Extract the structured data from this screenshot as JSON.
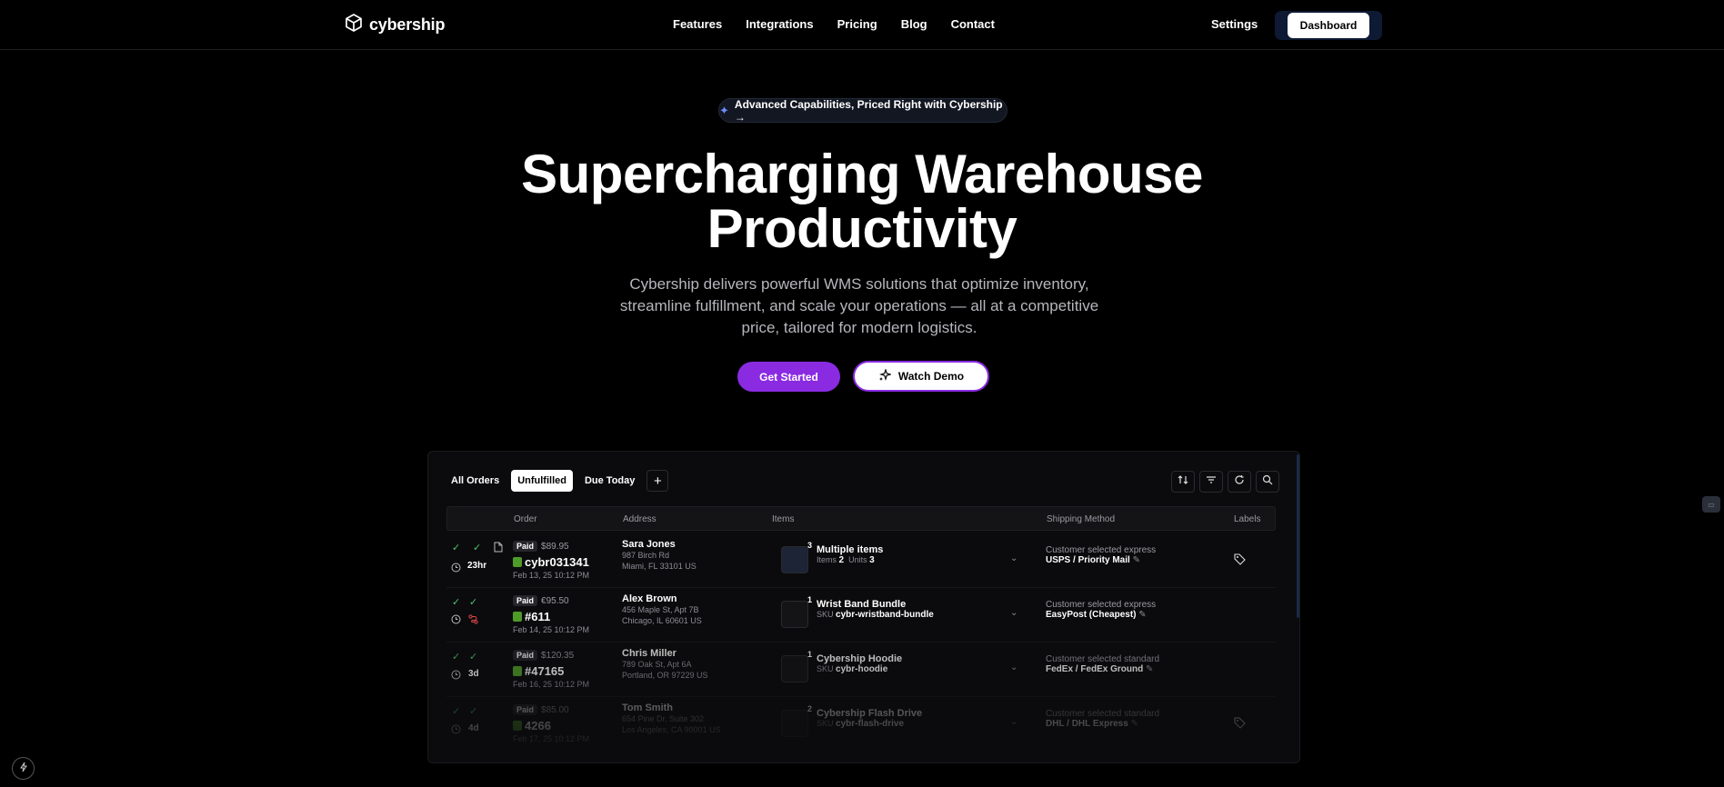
{
  "nav": {
    "brand": "cybership",
    "links": [
      "Features",
      "Integrations",
      "Pricing",
      "Blog",
      "Contact"
    ],
    "settings": "Settings",
    "dashboard": "Dashboard"
  },
  "hero": {
    "pill": "Advanced Capabilities, Priced Right with Cybership →",
    "title_line1": "Supercharging Warehouse",
    "title_line2": "Productivity",
    "subtitle": "Cybership delivers powerful WMS solutions that optimize inventory, streamline fulfillment, and scale your operations — all at a competitive price, tailored for modern logistics.",
    "primary_cta": "Get Started",
    "secondary_cta": "Watch Demo"
  },
  "orders": {
    "tabs": [
      "All Orders",
      "Unfulfilled",
      "Due Today"
    ],
    "active_tab": "Unfulfilled",
    "headers": {
      "order": "Order",
      "address": "Address",
      "items": "Items",
      "shipping": "Shipping Method",
      "labels": "Labels"
    },
    "rows": [
      {
        "age": "23hr",
        "status": "Paid",
        "price": "$89.95",
        "order": "cybr031341",
        "date": "Feb 13, 25 10:12 PM",
        "name": "Sara Jones",
        "addr1": "987 Birch Rd",
        "addr2": "Miami, FL 33101 US",
        "qty": "3",
        "item": "Multiple items",
        "items_label": "Items",
        "items_count": "2",
        "units_label": "Units",
        "units_count": "3",
        "ship_note": "Customer selected express",
        "carrier": "USPS / Priority Mail"
      },
      {
        "age": "",
        "status": "Paid",
        "price": "€95.50",
        "order": "#611",
        "date": "Feb 14, 25 10:12 PM",
        "name": "Alex Brown",
        "addr1": "456 Maple St, Apt 7B",
        "addr2": "Chicago, IL 60601 US",
        "qty": "1",
        "item": "Wrist Band Bundle",
        "sku_label": "SKU",
        "sku": "cybr-wristband-bundle",
        "ship_note": "Customer selected express",
        "carrier": "EasyPost (Cheapest)"
      },
      {
        "age": "3d",
        "status": "Paid",
        "price": "$120.35",
        "order": "#47165",
        "date": "Feb 16, 25 10:12 PM",
        "name": "Chris Miller",
        "addr1": "789 Oak St, Apt 6A",
        "addr2": "Portland, OR 97229 US",
        "qty": "1",
        "item": "Cybership Hoodie",
        "sku_label": "SKU",
        "sku": "cybr-hoodie",
        "ship_note": "Customer selected standard",
        "carrier": "FedEx / FedEx Ground"
      },
      {
        "age": "4d",
        "status": "Paid",
        "price": "$85.00",
        "order": "4266",
        "date": "Feb 17, 25 10:12 PM",
        "name": "Tom Smith",
        "addr1": "654 Pine Dr, Suite 302",
        "addr2": "Los Angeles, CA 90001 US",
        "qty": "2",
        "item": "Cybership Flash Drive",
        "sku_label": "SKU",
        "sku": "cybr-flash-drive",
        "ship_note": "Customer selected standard",
        "carrier": "DHL / DHL Express"
      }
    ]
  },
  "colors": {
    "accent": "#8a2be2",
    "background": "#000000",
    "check": "#4ec46a",
    "alert": "#e04848"
  }
}
